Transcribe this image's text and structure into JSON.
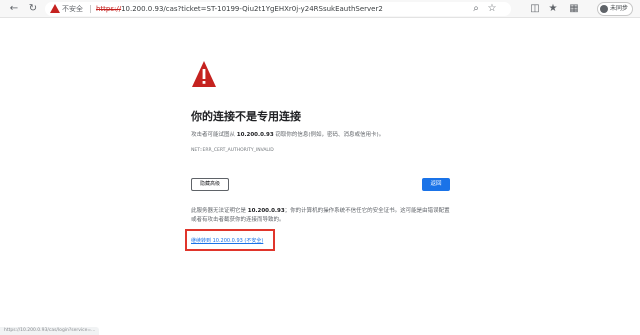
{
  "toolbar": {
    "security_label": "不安全",
    "url_scheme": "https://",
    "url_rest": "10.200.0.93/cas?ticket=ST-10199-Qiu2t1YgEHXr0j-y24RSsukEauthServer2",
    "profile_label": "未同步",
    "icons": [
      "back-icon",
      "refresh-icon",
      "warning-icon",
      "zoom-icon",
      "star-icon",
      "split-screen-icon",
      "favorites-icon",
      "extensions-icon"
    ]
  },
  "error": {
    "heading": "你的连接不是专用连接",
    "desc_prefix": "攻击者可能试图从",
    "host": "10.200.0.93",
    "desc_suffix": "窃取你的信息(例如，密码、消息或信用卡)。",
    "code": "NET::ERR_CERT_AUTHORITY_INVALID",
    "advanced_button": "隐藏高级",
    "back_button": "返回",
    "detail_prefix": "此服务器无法证明它是",
    "detail_host": "10.200.0.93",
    "detail_suffix": "；你的计算机的操作系统不信任它的安全证书。这可能是由错误配置或者有攻击者截获你的连接而导致的。",
    "proceed_link": "继续转到 10.200.0.93 (不安全)"
  },
  "status_url": "https://10.200.0.93/cas/login?service=..."
}
